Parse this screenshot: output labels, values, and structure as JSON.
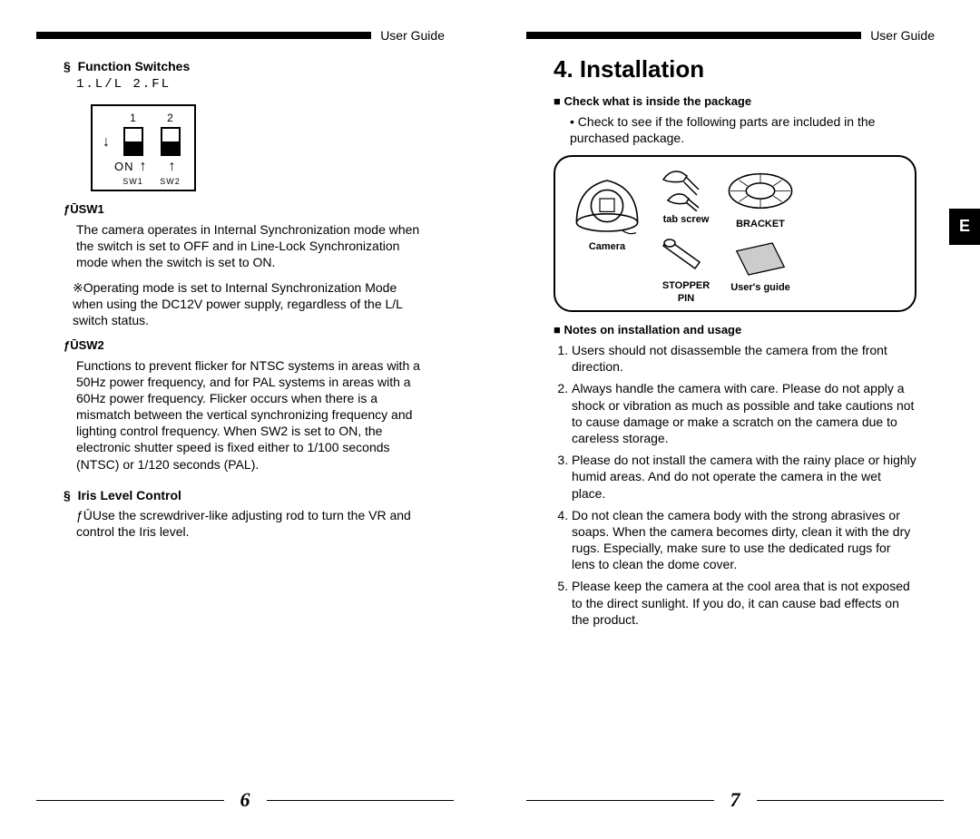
{
  "header": {
    "text": "User Guide"
  },
  "left": {
    "func_switches_heading": "§  Function Switches",
    "switch_caption": "1.L/L  2.FL",
    "switch_diagram": {
      "num1": "1",
      "num2": "2",
      "on": "ON",
      "sw1": "SW1",
      "sw2": "SW2"
    },
    "sw1_label": "ƒŪSW1",
    "sw1_text": "The camera operates in Internal Synchronization mode when the switch is set to OFF and in Line-Lock Synchronization mode when the switch is set to ON.",
    "sw1_note": "※Operating mode is set to Internal Synchronization Mode when using the DC12V power supply, regardless of the L/L switch status.",
    "sw2_label": "ƒŪSW2",
    "sw2_text": "Functions to prevent flicker for NTSC systems in areas with a 50Hz power frequency, and for PAL systems in areas with a 60Hz power frequency. Flicker occurs when there is a mismatch between the vertical synchronizing frequency and lighting control frequency. When SW2 is set to ON, the electronic shutter speed is fixed either to 1/100 seconds (NTSC) or 1/120 seconds (PAL).",
    "iris_heading": "§  Iris Level Control",
    "iris_text": "ƒŪUse the screwdriver-like adjusting rod to turn the VR and control the Iris level.",
    "pagenum": "6"
  },
  "right": {
    "title": "4. Installation",
    "check_heading": "Check what is inside the package",
    "check_text": "Check to see if the following parts are included in the purchased package.",
    "lang_tab": "E",
    "pkg": {
      "camera": "Camera",
      "tab_screw": "tab screw",
      "stopper_pin": "STOPPER\nPIN",
      "bracket": "BRACKET",
      "users_guide": "User's guide"
    },
    "notes_heading": "Notes on installation and usage",
    "notes": [
      "Users should not disassemble the camera from the front direction.",
      "Always handle the camera with care. Please do not apply a shock or vibration as much as possible and take cautions not to cause damage or make a scratch on the camera due to careless storage.",
      "Please do not install the camera with the rainy place or highly humid areas. And do not operate the camera in the wet place.",
      "Do not clean the camera body with the strong abrasives or soaps. When the camera becomes dirty, clean it with the dry rugs. Especially, make sure to use the dedicated rugs for lens to clean the dome cover.",
      "Please keep the camera at the cool area that is not exposed to the direct sunlight. If you do, it can cause bad effects on the product."
    ],
    "pagenum": "7"
  }
}
